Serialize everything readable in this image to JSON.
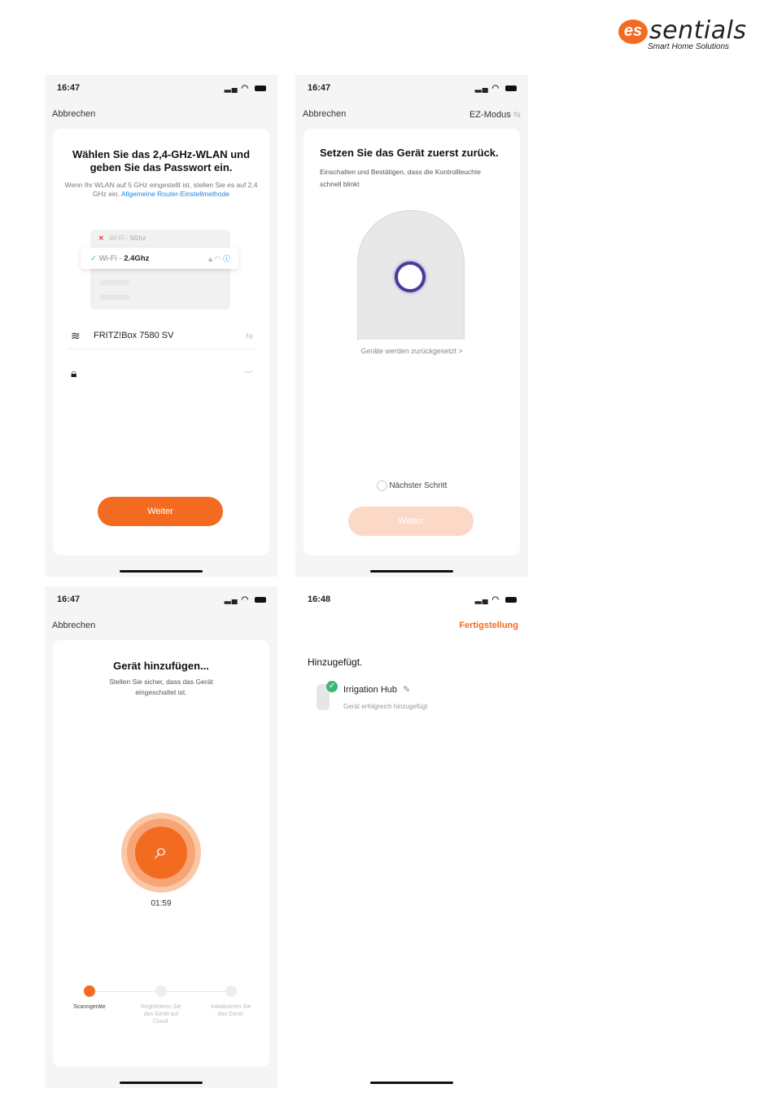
{
  "brand": {
    "logo_text": "essentials",
    "tagline": "Smart Home Solutions"
  },
  "screen1": {
    "time": "16:47",
    "cancel": "Abbrechen",
    "title": "Wählen Sie das 2,4-GHz-WLAN und geben Sie das Passwort ein.",
    "hint": "Wenn Ihr WLAN auf 5 GHz eingestellt ist, stellen Sie es auf 2,4 GHz ein.",
    "hint_link": "Allgemeine Router-Einstellmethode",
    "wifi_5g_prefix": "Wi-Fi - ",
    "wifi_5g": "5Ghz",
    "wifi_24_prefix": "Wi-Fi - ",
    "wifi_24": "2.4Ghz",
    "ssid": "FRITZ!Box 7580 SV",
    "password": "",
    "button": "Weiter"
  },
  "screen2": {
    "time": "16:47",
    "cancel": "Abbrechen",
    "mode": "EZ-Modus",
    "title": "Setzen Sie das Gerät zuerst zurück.",
    "subtitle": "Einschalten und Bestätigen, dass die Kontrollleuchte schnell blinkt",
    "reset_link": "Geräte werden zurückgesetzt >",
    "next_step": "Nächster Schritt",
    "button": "Weiter"
  },
  "screen3": {
    "time": "16:47",
    "cancel": "Abbrechen",
    "title": "Gerät hinzufügen...",
    "subtitle": "Stellen Sie sicher, dass das Gerät eingeschaltet ist.",
    "timer": "01:59",
    "steps": [
      "Scanngeräte",
      "Registrieren Sie das Gerät auf Cloud.",
      "Initialisieren Sie das Gerät."
    ]
  },
  "screen4": {
    "time": "16:48",
    "done": "Fertigstellung",
    "added": "Hinzugefügt.",
    "device_name": "Irrigation Hub",
    "device_status": "Gerät erfolgreich hinzugefügt"
  },
  "colors": {
    "accent": "#f26b21",
    "link": "#1e86e6",
    "success": "#3cb878"
  }
}
